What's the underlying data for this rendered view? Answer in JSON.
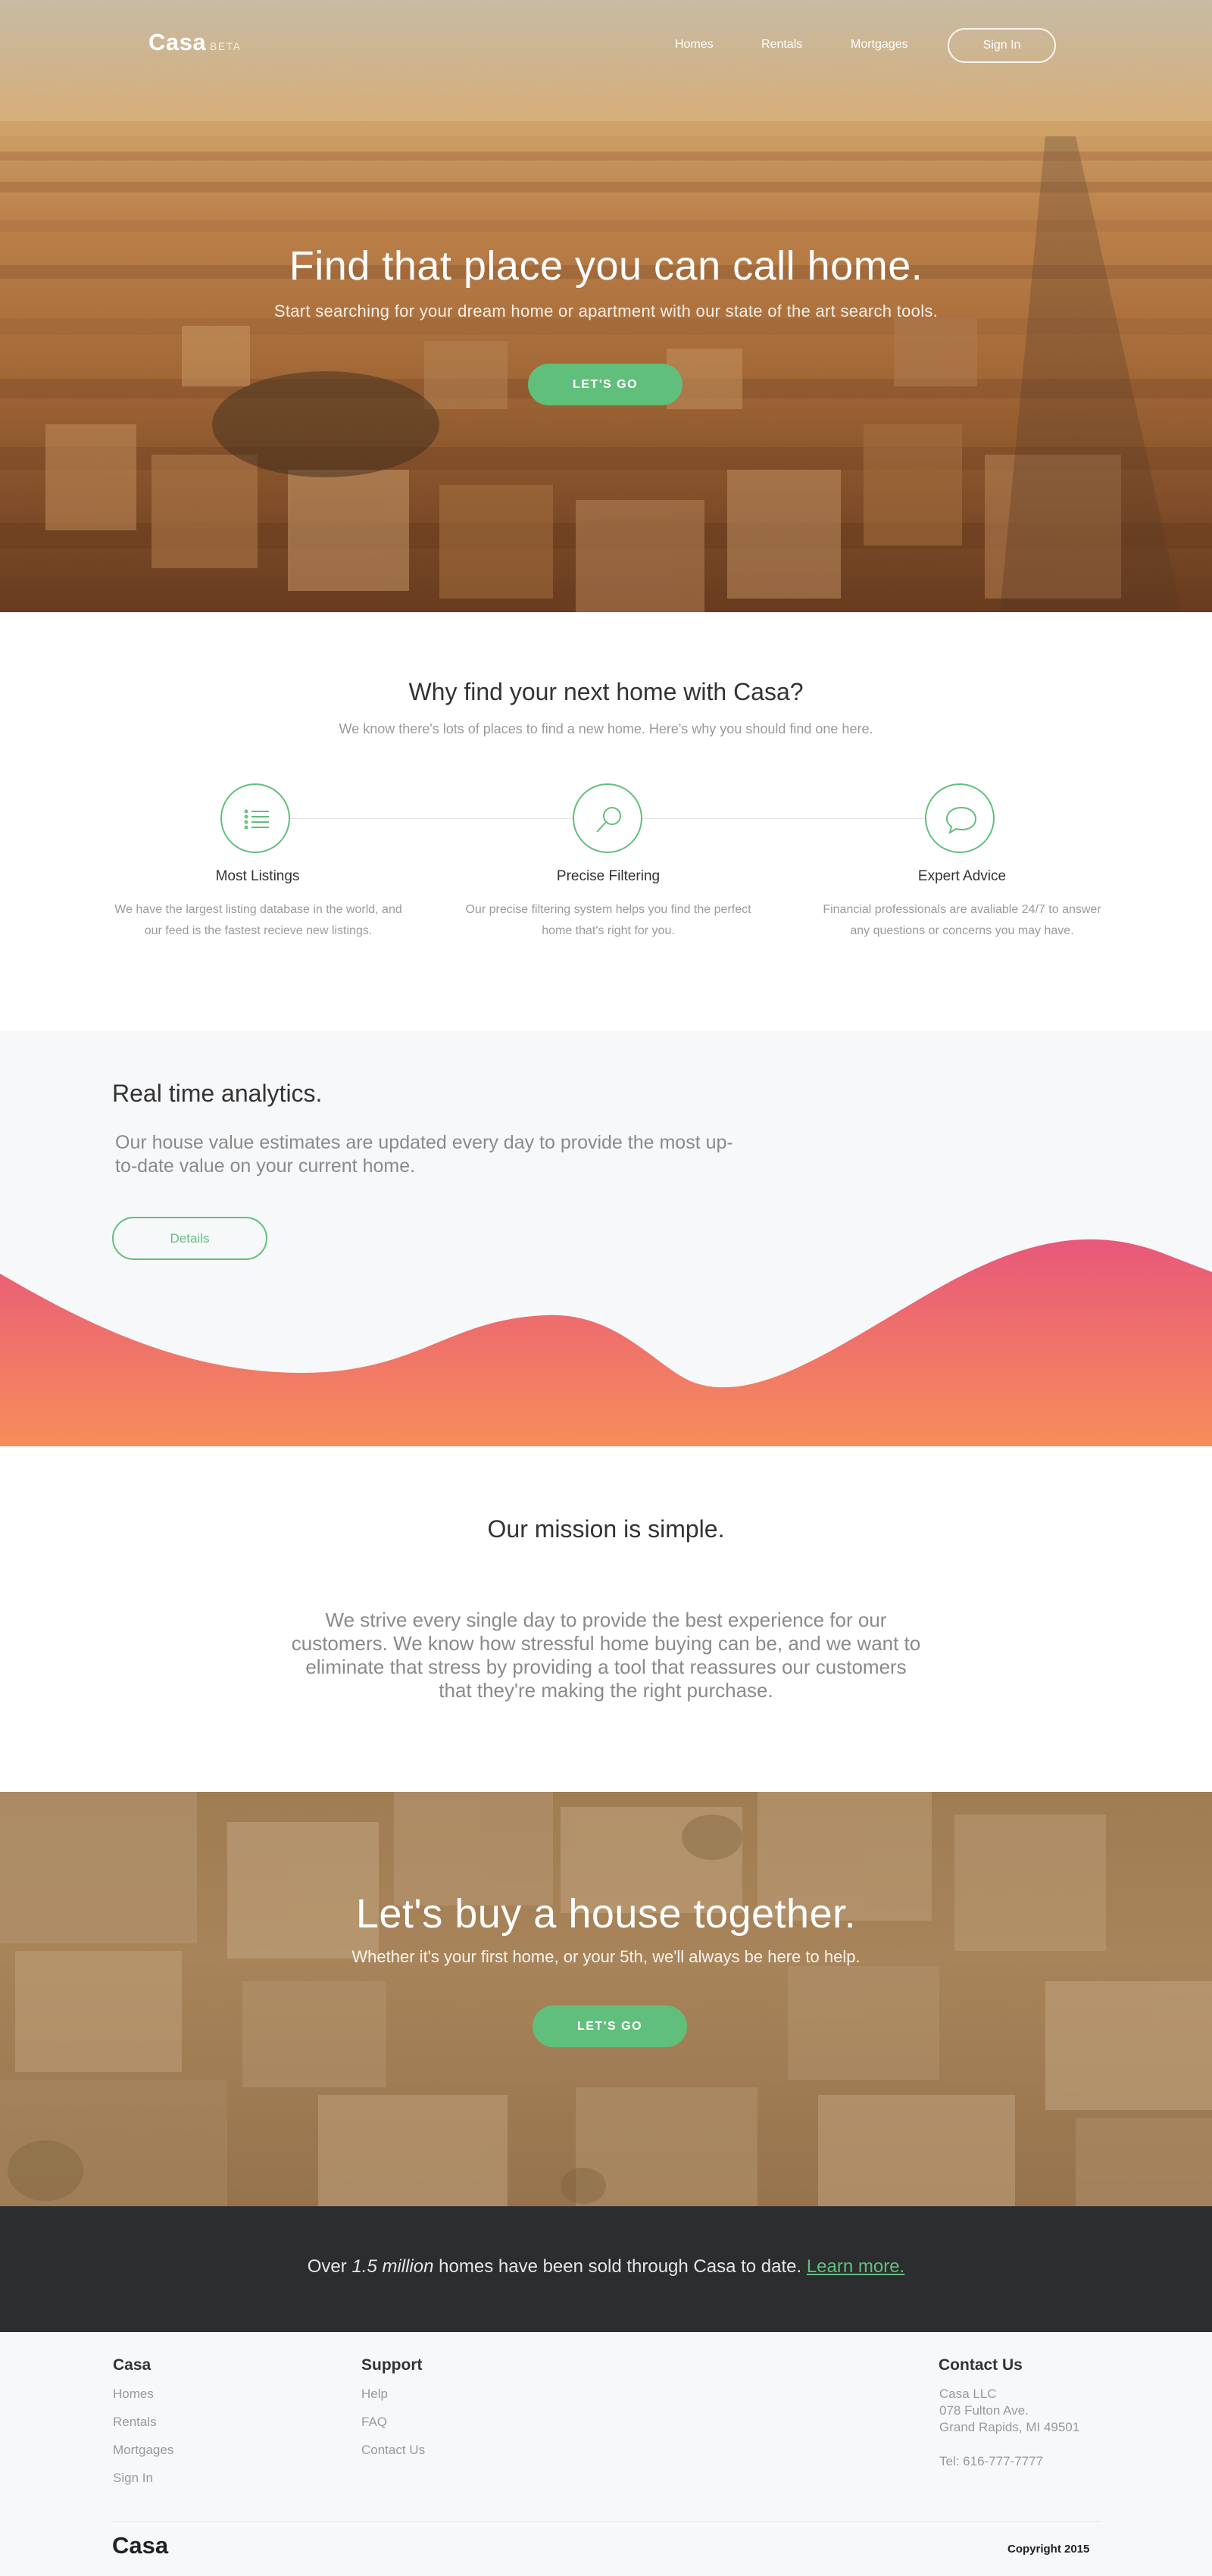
{
  "nav": {
    "logo": "Casa",
    "badge": "BETA",
    "links": [
      "Homes",
      "Rentals",
      "Mortgages"
    ],
    "signin": "Sign In"
  },
  "hero": {
    "title": "Find that place you can call home.",
    "subtitle": "Start searching for your dream home or apartment with our state of the art search tools.",
    "cta": "LET'S GO"
  },
  "why": {
    "title": "Why find your next home with Casa?",
    "subtitle": "We know there's lots of places to find a new home. Here's why you should find one here.",
    "features": [
      {
        "icon": "list-icon",
        "title": "Most Listings",
        "desc": "We have the largest listing database in the world, and our feed is the fastest recieve new listings."
      },
      {
        "icon": "search-icon",
        "title": "Precise Filtering",
        "desc": "Our precise filtering system helps you find the perfect home that's right for you."
      },
      {
        "icon": "chat-bubble-icon",
        "title": "Expert Advice",
        "desc": "Financial professionals are avaliable 24/7 to answer any questions or concerns you may have."
      }
    ]
  },
  "analytics": {
    "title": "Real time analytics.",
    "description": "Our house value estimates are updated every day to provide the most up-to-date value on your current home.",
    "button": "Details"
  },
  "mission": {
    "title": "Our mission is simple.",
    "text": "We strive every single day to provide the best experience for our customers. We know how stressful home buying can be, and we want to eliminate that stress by providing a tool that reassures our customers that they're making the right purchase."
  },
  "buy": {
    "title": "Let's buy a house together.",
    "subtitle": "Whether it's your first home, or your 5th, we'll always be here to help.",
    "cta": "LET'S GO"
  },
  "stats": {
    "prefix": "Over ",
    "highlight": "1.5 million",
    "suffix": " homes have been sold through Casa to date. ",
    "link": "Learn more."
  },
  "footer": {
    "col1": {
      "title": "Casa",
      "links": [
        "Homes",
        "Rentals",
        "Mortgages",
        "Sign In"
      ]
    },
    "col2": {
      "title": "Support",
      "links": [
        "Help",
        "FAQ",
        "Contact Us"
      ]
    },
    "contact": {
      "title": "Contact Us",
      "company": "Casa LLC",
      "street": "078 Fulton Ave.",
      "city": "Grand Rapids, MI 49501",
      "phone": "Tel: 616-777-7777"
    },
    "logo": "Casa",
    "copyright": "Copyright 2015"
  },
  "colors": {
    "accent": "#61bf7c",
    "wave_top": "#ea5f78",
    "wave_bottom": "#f68b5c",
    "dark": "#2b2d2f",
    "light_bg": "#f7f8fa"
  }
}
